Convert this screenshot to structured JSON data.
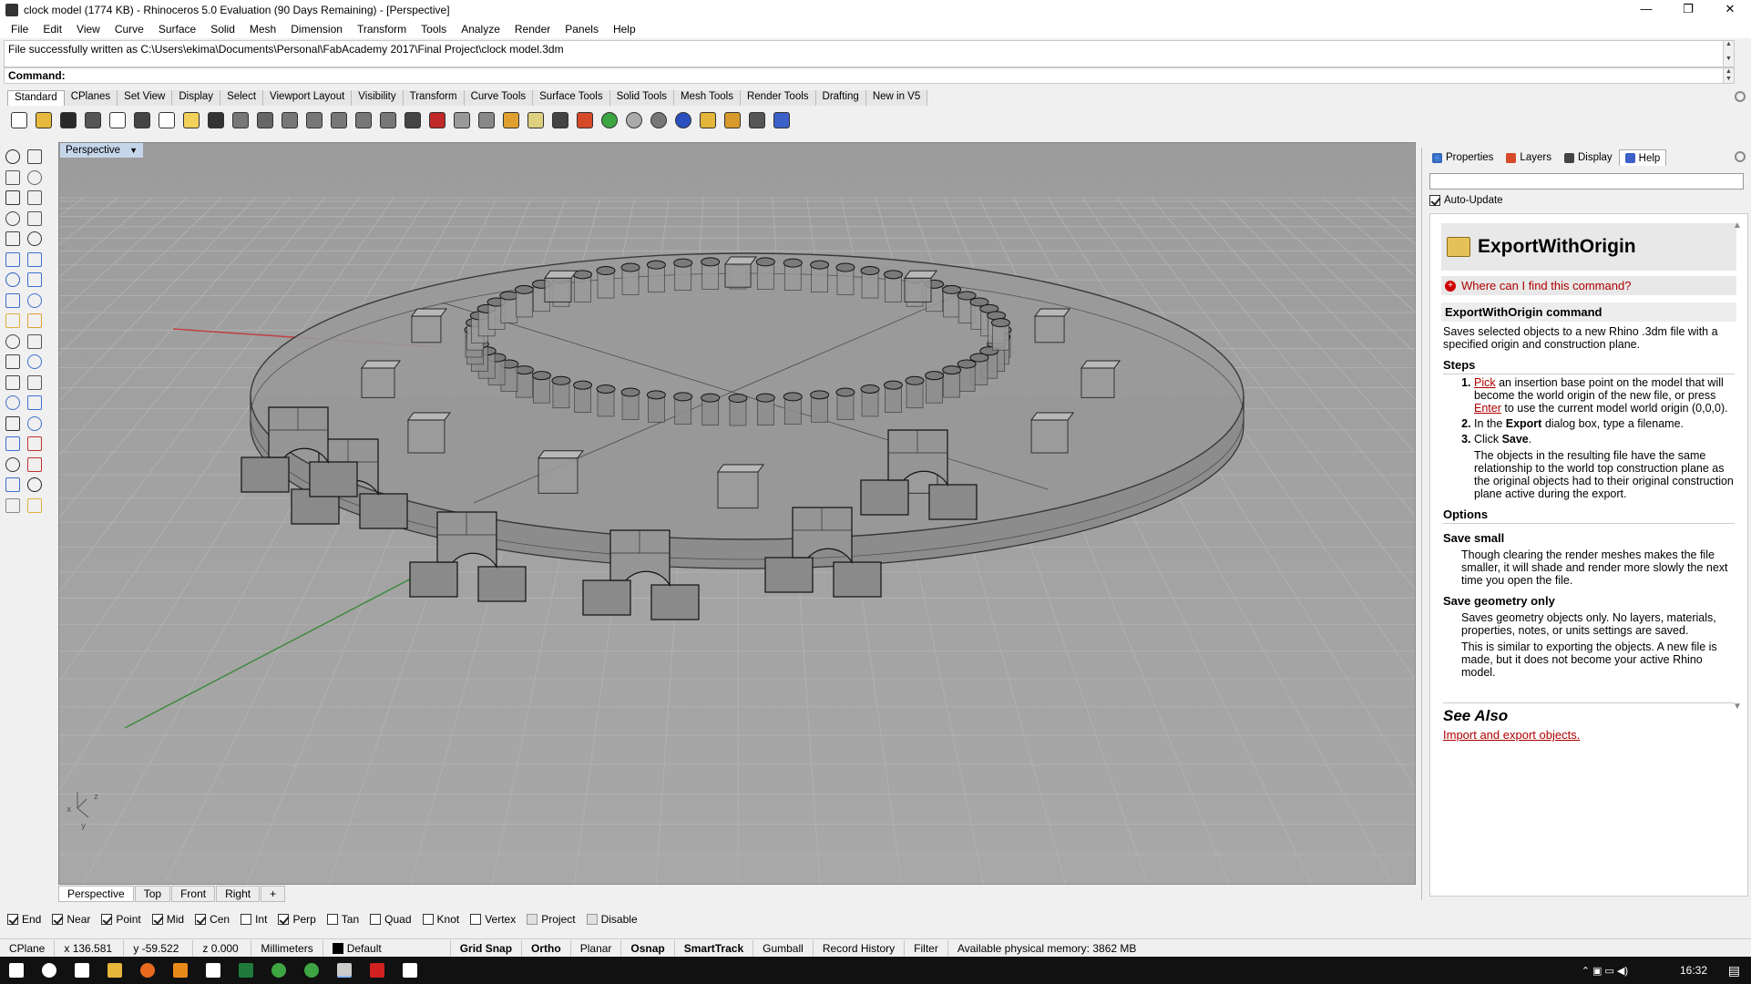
{
  "window": {
    "title": "clock model (1774 KB) - Rhinoceros 5.0 Evaluation (90 Days Remaining) - [Perspective]",
    "controls": [
      "—",
      "❐",
      "✕"
    ]
  },
  "menu": [
    "File",
    "Edit",
    "View",
    "Curve",
    "Surface",
    "Solid",
    "Mesh",
    "Dimension",
    "Transform",
    "Tools",
    "Analyze",
    "Render",
    "Panels",
    "Help"
  ],
  "history_text": "File successfully written as C:\\Users\\ekima\\Documents\\Personal\\FabAcademy 2017\\Final Project\\clock model.3dm",
  "command_label": "Command:",
  "toolbar_tabs": [
    "Standard",
    "CPlanes",
    "Set View",
    "Display",
    "Select",
    "Viewport Layout",
    "Visibility",
    "Transform",
    "Curve Tools",
    "Surface Tools",
    "Solid Tools",
    "Mesh Tools",
    "Render Tools",
    "Drafting",
    "New in V5"
  ],
  "toolbar_icons": [
    {
      "name": "new-icon",
      "color": "#ffffff"
    },
    {
      "name": "open-icon",
      "color": "#e7b93c"
    },
    {
      "name": "save-icon",
      "color": "#2a2a2a"
    },
    {
      "name": "print-icon",
      "color": "#555555"
    },
    {
      "name": "import-icon",
      "color": "#ffffff"
    },
    {
      "name": "cut-icon",
      "color": "#444444"
    },
    {
      "name": "copy-icon",
      "color": "#ffffff"
    },
    {
      "name": "paste-icon",
      "color": "#f2d05a"
    },
    {
      "name": "undo-icon",
      "color": "#333333"
    },
    {
      "name": "pan-icon",
      "color": "#777777"
    },
    {
      "name": "rotate-view-icon",
      "color": "#666666"
    },
    {
      "name": "zoom-icon",
      "color": "#777777"
    },
    {
      "name": "zoom-window-icon",
      "color": "#777777"
    },
    {
      "name": "zoom-extents-icon",
      "color": "#777777"
    },
    {
      "name": "zoom-selected-icon",
      "color": "#777777"
    },
    {
      "name": "undo-view-icon",
      "color": "#777777"
    },
    {
      "name": "four-views-icon",
      "color": "#444444"
    },
    {
      "name": "car-icon",
      "color": "#c0282a"
    },
    {
      "name": "properties-icon",
      "color": "#999999"
    },
    {
      "name": "lock-icon",
      "color": "#888888"
    },
    {
      "name": "select-icon",
      "color": "#e0a030"
    },
    {
      "name": "light-icon",
      "color": "#ddd080"
    },
    {
      "name": "padlock-icon",
      "color": "#444444"
    },
    {
      "name": "shield-icon",
      "color": "#d64a28"
    },
    {
      "name": "color-wheel-icon",
      "color": "#3da542"
    },
    {
      "name": "sphere-icon",
      "color": "#aaaaaa"
    },
    {
      "name": "render-sphere-icon",
      "color": "#777777"
    },
    {
      "name": "blue-sphere-icon",
      "color": "#2b4fbf"
    },
    {
      "name": "wand-icon",
      "color": "#e3b53a"
    },
    {
      "name": "gears-icon",
      "color": "#d89a2b"
    },
    {
      "name": "dimension-icon",
      "color": "#555555"
    },
    {
      "name": "help-icon",
      "color": "#3b61c8"
    }
  ],
  "left_tools": [
    "select-arrow-icon",
    "point-icon",
    "polyline-icon",
    "control-point-curve-icon",
    "circle-icon",
    "ellipse-icon",
    "arc-icon",
    "rectangle-icon",
    "polygon-icon",
    "curve-fillet-icon",
    "extrude-curve-icon",
    "surface-icon",
    "box-icon",
    "sphere-icon",
    "cylinder-icon",
    "mesh-icon",
    "boolean-union-icon",
    "lightning-icon",
    "move-icon",
    "join-icon",
    "explode-icon",
    "group-icon",
    "trim-icon",
    "split-icon",
    "text-icon",
    "dimension-icon",
    "array-icon",
    "align-icon",
    "solid-icon",
    "block-icon",
    "grid-array-icon",
    "history-icon",
    "analyze-icon",
    "check-icon",
    "render-icon",
    "light-icon"
  ],
  "viewport": {
    "label": "Perspective",
    "tabs": [
      "Perspective",
      "Top",
      "Front",
      "Right"
    ],
    "add_tab": "+",
    "axes": {
      "x": "x",
      "y": "y",
      "z": "z"
    }
  },
  "osnaps": [
    {
      "label": "End",
      "on": true
    },
    {
      "label": "Near",
      "on": true
    },
    {
      "label": "Point",
      "on": true
    },
    {
      "label": "Mid",
      "on": true
    },
    {
      "label": "Cen",
      "on": true
    },
    {
      "label": "Int",
      "on": false
    },
    {
      "label": "Perp",
      "on": true
    },
    {
      "label": "Tan",
      "on": false
    },
    {
      "label": "Quad",
      "on": false
    },
    {
      "label": "Knot",
      "on": false
    },
    {
      "label": "Vertex",
      "on": false
    },
    {
      "label": "Project",
      "on": false
    },
    {
      "label": "Disable",
      "on": false
    }
  ],
  "status": {
    "cplane": "CPlane",
    "x": "x 136.581",
    "y": "y -59.522",
    "z": "z 0.000",
    "units": "Millimeters",
    "layer": "Default",
    "grid_snap": "Grid Snap",
    "ortho": "Ortho",
    "planar": "Planar",
    "osnap": "Osnap",
    "smarttrack": "SmartTrack",
    "gumball": "Gumball",
    "record_history": "Record History",
    "filter": "Filter",
    "memory": "Available physical memory: 3862 MB"
  },
  "panel": {
    "tabs": [
      "Properties",
      "Layers",
      "Display",
      "Help"
    ],
    "auto_update": "Auto-Update",
    "help": {
      "command": "ExportWithOrigin",
      "where": "Where can I find this command?",
      "section_title": "ExportWithOrigin command",
      "summary": "Saves selected objects to a new Rhino .3dm file with a specified origin and construction plane.",
      "steps_title": "Steps",
      "step1_link1": "Pick",
      "step1_a": " an insertion base point on the model that will become the world origin of the new file, or press ",
      "step1_link2": "Enter",
      "step1_b": " to use the current model world origin (0,0,0).",
      "step2_a": "In the ",
      "step2_bold": "Export",
      "step2_b": " dialog box, type a filename.",
      "step3_a": "Click ",
      "step3_bold": "Save",
      "step3_b": ".",
      "steps_note": "The objects in the resulting file have the same relationship to the world top construction plane as the original objects had to their original construction plane active during the export.",
      "options_title": "Options",
      "opt1_title": "Save small",
      "opt1_text": "Though clearing the render meshes makes the file smaller, it will shade and render more slowly the next time you open the file.",
      "opt2_title": "Save geometry only",
      "opt2_text": "Saves geometry objects only. No layers, materials, properties, notes, or units settings are saved.",
      "opt2_text2": "This is similar to exporting the objects. A new file is made, but it does not become your active Rhino model.",
      "see_also": "See Also",
      "see_also_link": "Import and export objects."
    }
  },
  "taskbar": {
    "time": "16:32",
    "icons": [
      "windows-start-icon",
      "search-icon",
      "task-view-icon",
      "file-explorer-icon",
      "firefox-icon",
      "vlc-icon",
      "mail-icon",
      "excel-icon",
      "chrome-icon",
      "chrome-alt-icon",
      "rhino-icon",
      "acrobat-icon",
      "settings-icon"
    ]
  }
}
